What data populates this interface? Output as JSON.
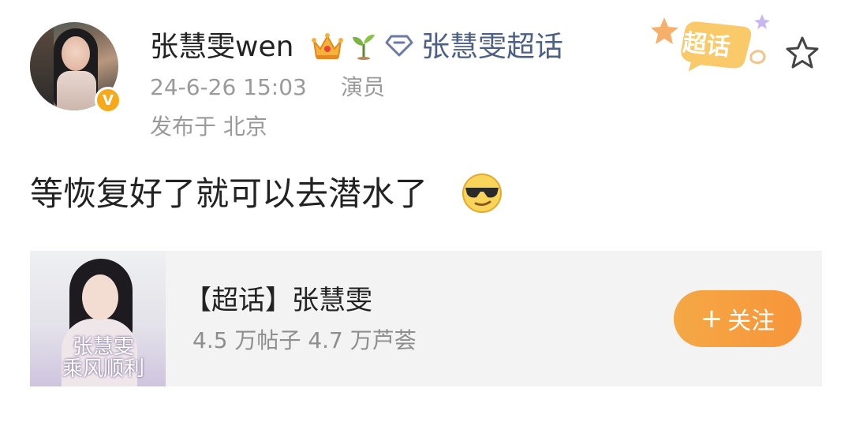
{
  "post": {
    "author": {
      "name": "张慧雯wen",
      "verified_badge": "V"
    },
    "topic_link": "张慧雯超话",
    "timestamp": "24-6-26 15:03",
    "role": "演员",
    "location": "发布于 北京",
    "content": "等恢复好了就可以去潜水了",
    "chaohua_badge": "超话",
    "icons": [
      "crown-icon",
      "sprout-icon",
      "diamond-icon",
      "star-icon",
      "cool-sunglasses-emoji"
    ]
  },
  "topic_card": {
    "title": "【超话】张慧雯",
    "stats": "4.5 万帖子 4.7 万芦荟",
    "image_text_line1": "张慧雯",
    "image_text_line2": "乘风顺利",
    "follow_plus": "+",
    "follow_label": "关注"
  },
  "colors": {
    "link": "#4c5f87",
    "meta": "#9a9a9a",
    "follow_button": "#f7953a",
    "verified_badge": "#f7a91a",
    "card_background": "#f3f3f3"
  }
}
